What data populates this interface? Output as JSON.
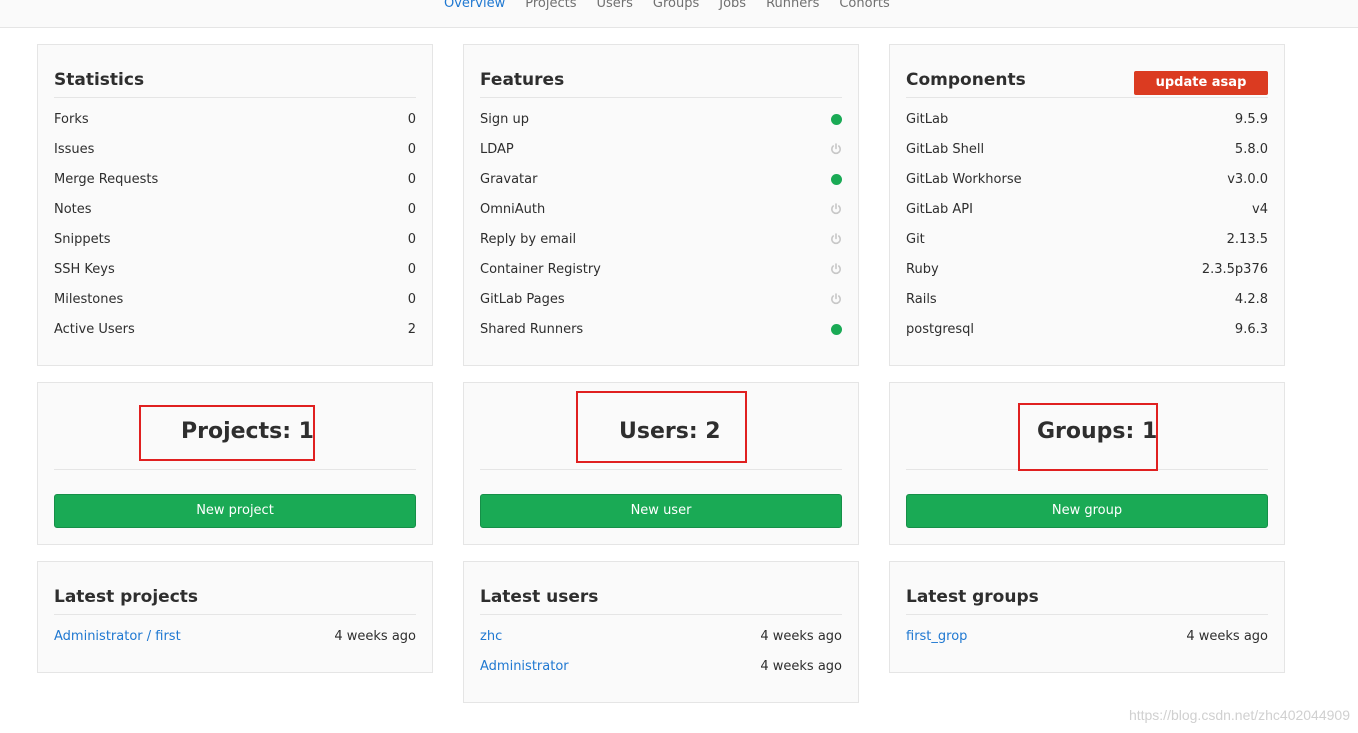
{
  "nav": {
    "tabs": [
      {
        "label": "Overview",
        "active": true
      },
      {
        "label": "Projects",
        "active": false
      },
      {
        "label": "Users",
        "active": false
      },
      {
        "label": "Groups",
        "active": false
      },
      {
        "label": "Jobs",
        "active": false
      },
      {
        "label": "Runners",
        "active": false
      },
      {
        "label": "Cohorts",
        "active": false
      }
    ]
  },
  "statistics": {
    "title": "Statistics",
    "rows": [
      {
        "label": "Forks",
        "value": "0"
      },
      {
        "label": "Issues",
        "value": "0"
      },
      {
        "label": "Merge Requests",
        "value": "0"
      },
      {
        "label": "Notes",
        "value": "0"
      },
      {
        "label": "Snippets",
        "value": "0"
      },
      {
        "label": "SSH Keys",
        "value": "0"
      },
      {
        "label": "Milestones",
        "value": "0"
      },
      {
        "label": "Active Users",
        "value": "2"
      }
    ]
  },
  "features": {
    "title": "Features",
    "rows": [
      {
        "label": "Sign up",
        "status": "on"
      },
      {
        "label": "LDAP",
        "status": "off"
      },
      {
        "label": "Gravatar",
        "status": "on"
      },
      {
        "label": "OmniAuth",
        "status": "off"
      },
      {
        "label": "Reply by email",
        "status": "off"
      },
      {
        "label": "Container Registry",
        "status": "off"
      },
      {
        "label": "GitLab Pages",
        "status": "off"
      },
      {
        "label": "Shared Runners",
        "status": "on"
      }
    ]
  },
  "components": {
    "title": "Components",
    "update_label": "update asap",
    "rows": [
      {
        "label": "GitLab",
        "value": "9.5.9"
      },
      {
        "label": "GitLab Shell",
        "value": "5.8.0"
      },
      {
        "label": "GitLab Workhorse",
        "value": "v3.0.0"
      },
      {
        "label": "GitLab API",
        "value": "v4"
      },
      {
        "label": "Git",
        "value": "2.13.5"
      },
      {
        "label": "Ruby",
        "value": "2.3.5p376"
      },
      {
        "label": "Rails",
        "value": "4.2.8"
      },
      {
        "label": "postgresql",
        "value": "9.6.3"
      }
    ]
  },
  "counts": {
    "projects": {
      "text": "Projects: 1",
      "button": "New project"
    },
    "users": {
      "text": "Users: 2",
      "button": "New user"
    },
    "groups": {
      "text": "Groups: 1",
      "button": "New group"
    }
  },
  "latest_projects": {
    "title": "Latest projects",
    "rows": [
      {
        "name": "Administrator / first",
        "time": "4 weeks ago"
      }
    ]
  },
  "latest_users": {
    "title": "Latest users",
    "rows": [
      {
        "name": "zhc",
        "time": "4 weeks ago"
      },
      {
        "name": "Administrator",
        "time": "4 weeks ago"
      }
    ]
  },
  "latest_groups": {
    "title": "Latest groups",
    "rows": [
      {
        "name": "first_grop",
        "time": "4 weeks ago"
      }
    ]
  },
  "colors": {
    "feature_on": "#1aaa55",
    "feature_off": "#c7c7c7",
    "update_badge": "#db3b21",
    "highlight": "#e02020"
  },
  "watermark": "https://blog.csdn.net/zhc402044909"
}
